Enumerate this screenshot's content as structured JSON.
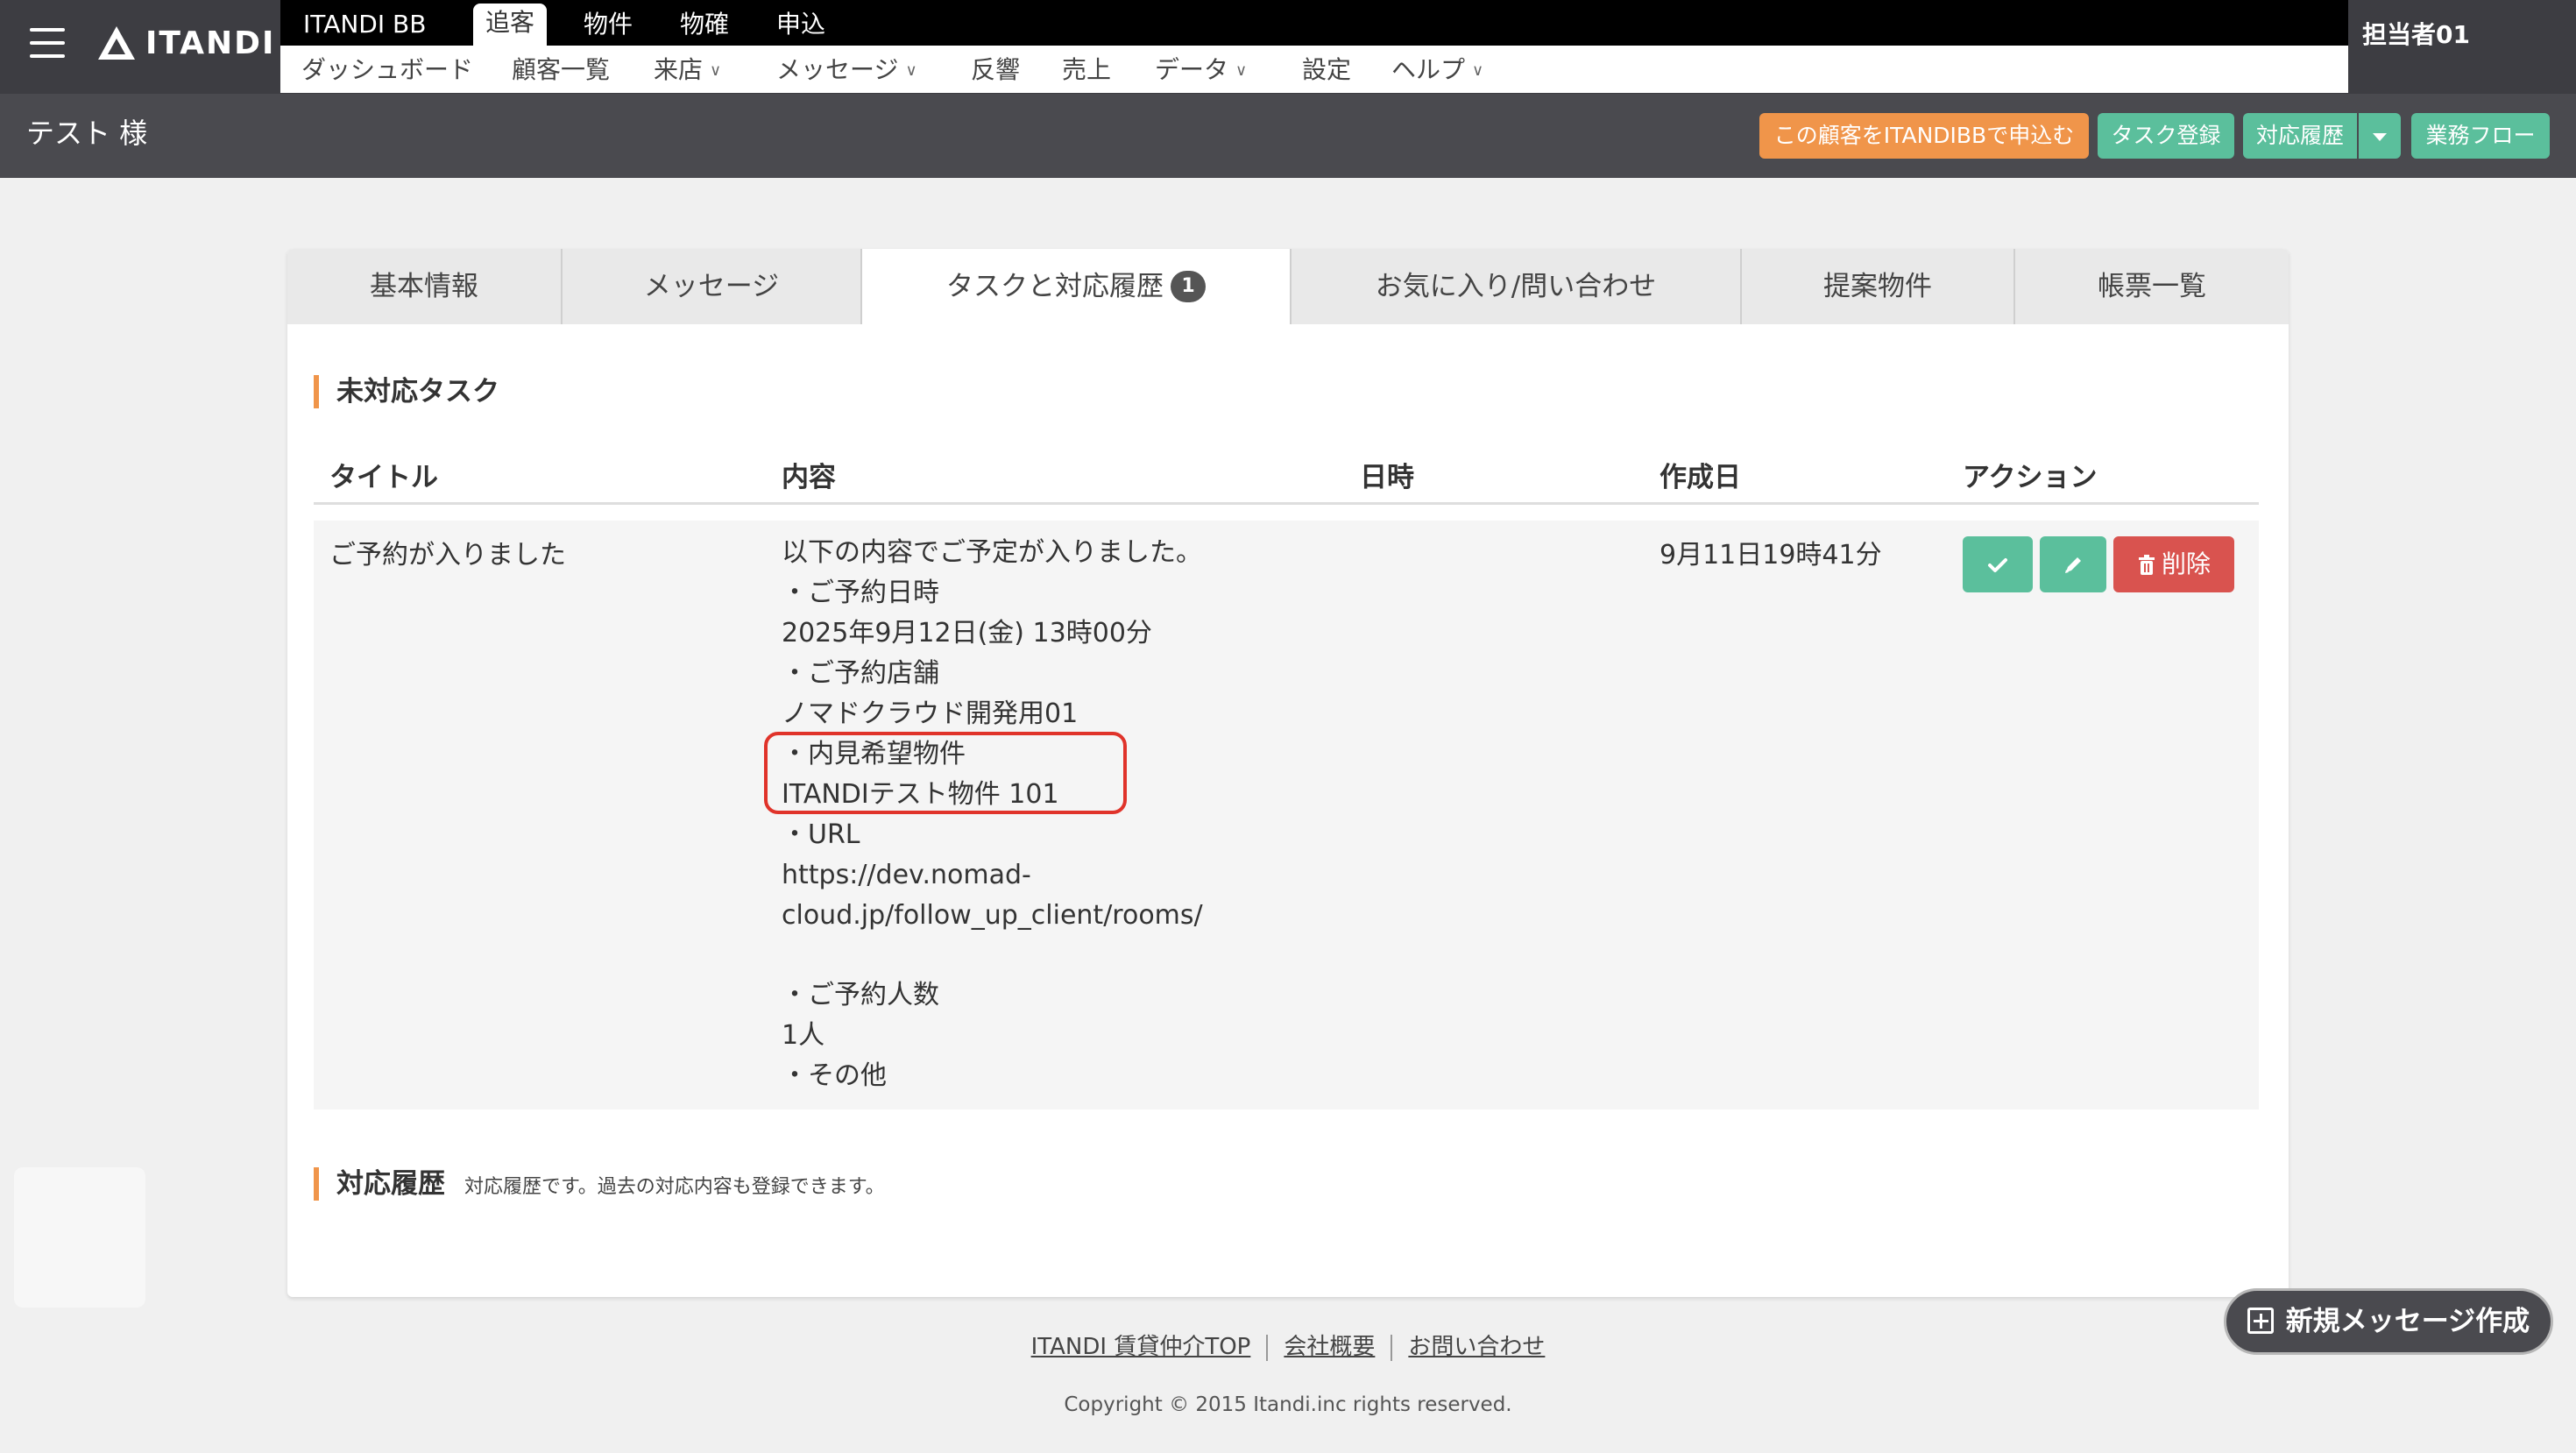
{
  "brand": {
    "logo_text": "ITANDI"
  },
  "service_tabs": [
    "ITANDI BB",
    "追客",
    "物件",
    "物確",
    "申込"
  ],
  "active_service_tab": "追客",
  "menu": {
    "dashboard": "ダッシュボード",
    "customers": "顧客一覧",
    "visit": "来店",
    "message": "メッセージ",
    "response": "反響",
    "sales": "売上",
    "data": "データ",
    "settings": "設定",
    "help": "ヘルプ"
  },
  "user": {
    "name": "担当者01"
  },
  "customer": {
    "name": "テスト 様"
  },
  "header_buttons": {
    "apply_bb": "この顧客をITANDIBBで申込む",
    "task_register": "タスク登録",
    "history": "対応履歴",
    "workflow": "業務フロー"
  },
  "tabs": {
    "basic": "基本情報",
    "message": "メッセージ",
    "tasks": "タスクと対応履歴",
    "tasks_badge": "1",
    "favorites": "お気に入り/問い合わせ",
    "proposals": "提案物件",
    "documents": "帳票一覧"
  },
  "pending_tasks": {
    "title": "未対応タスク",
    "columns": {
      "title": "タイトル",
      "content": "内容",
      "datetime": "日時",
      "created": "作成日",
      "action": "アクション"
    },
    "row": {
      "title": "ご予約が入りました",
      "content_lines": [
        "以下の内容でご予定が入りました。",
        "・ご予約日時",
        "2025年9月12日(金) 13時00分",
        "・ご予約店舗",
        "ノマドクラウド開発用01",
        "・内見希望物件",
        "ITANDIテスト物件 101",
        "・URL",
        "https://dev.nomad-",
        "cloud.jp/follow_up_client/rooms/",
        "",
        "・ご予約人数",
        "1人",
        "・その他"
      ],
      "datetime": "",
      "created": "9月11日19時41分",
      "delete_label": "削除"
    }
  },
  "history_section": {
    "title": "対応履歴",
    "description": "対応履歴です。過去の対応内容も登録できます。"
  },
  "footer": {
    "links": [
      "ITANDI 賃貸仲介TOP",
      "会社概要",
      "お問い合わせ"
    ],
    "copyright": "Copyright © 2015 Itandi.inc rights reserved."
  },
  "floating": {
    "new_message": "新規メッセージ作成"
  },
  "colors": {
    "accent_orange": "#f0954a",
    "accent_green": "#5bbf9c",
    "danger_red": "#d9534f",
    "highlight_red": "#e0332a"
  }
}
